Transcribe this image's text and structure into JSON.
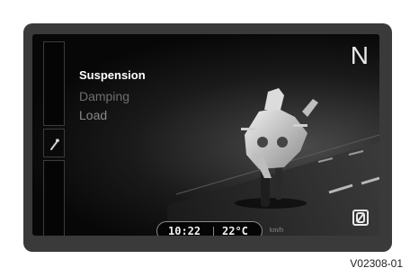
{
  "display": {
    "gear": "N",
    "menu": {
      "title": "Suspension",
      "items": [
        "Damping",
        "Load"
      ]
    },
    "status": {
      "time": "10:22",
      "temperature": "22°C",
      "speed_unit": "km/h"
    },
    "sidebar_icon": "wrench-icon",
    "bottom_icon": "zero-slash-icon",
    "illustration": "motorcycle"
  },
  "figure_code": "V02308-01"
}
